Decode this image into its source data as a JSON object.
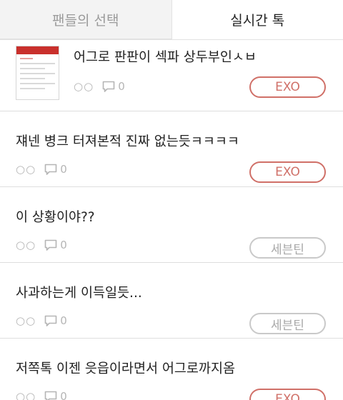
{
  "tabs": [
    {
      "label": "팬들의 선택"
    },
    {
      "label": "실시간 톡"
    }
  ],
  "posts": [
    {
      "title": "어그로 판판이 섹파 상두부인ㅅㅂ",
      "views": "○○",
      "comments": "0",
      "tag": "EXO",
      "tag_color": "#d07068"
    },
    {
      "title": "쟤넨 병크 터져본적 진짜 없는듯ㅋㅋㅋㅋ",
      "views": "○○",
      "comments": "0",
      "tag": "EXO",
      "tag_color": "#d07068"
    },
    {
      "title": "이 상황이야??",
      "views": "○○",
      "comments": "0",
      "tag": "세븐틴",
      "tag_color": "#c9c9c9"
    },
    {
      "title": "사과하는게 이득일듯...",
      "views": "○○",
      "comments": "0",
      "tag": "세븐틴",
      "tag_color": "#c9c9c9"
    },
    {
      "title": "저쪽톡 이젠 읏읍이라면서 어그로까지옴",
      "views": "○○",
      "comments": "0",
      "tag": "EXO",
      "tag_color": "#d07068"
    }
  ],
  "icons": {
    "views": "views-icon",
    "comments": "comment-icon"
  }
}
